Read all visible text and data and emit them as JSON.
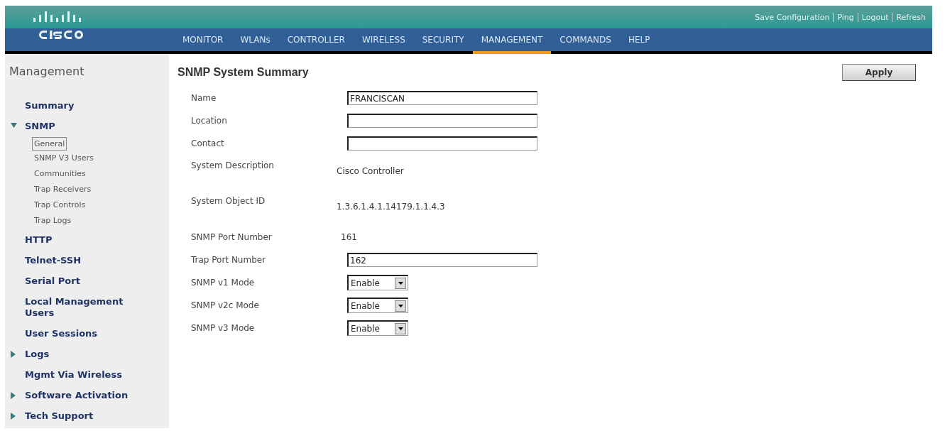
{
  "header": {
    "top_links": [
      "Save Configuration",
      "Ping",
      "Logout",
      "Refresh"
    ],
    "nav": [
      {
        "label": "MONITOR",
        "selected": false
      },
      {
        "label": "WLANs",
        "selected": false
      },
      {
        "label": "CONTROLLER",
        "selected": false
      },
      {
        "label": "WIRELESS",
        "selected": false
      },
      {
        "label": "SECURITY",
        "selected": false
      },
      {
        "label": "MANAGEMENT",
        "selected": true
      },
      {
        "label": "COMMANDS",
        "selected": false
      },
      {
        "label": "HELP",
        "selected": false
      }
    ]
  },
  "sidebar": {
    "title": "Management",
    "items": [
      {
        "label": "Summary"
      },
      {
        "label": "SNMP",
        "expanded": true,
        "children": [
          {
            "label": "General",
            "selected": true
          },
          {
            "label": "SNMP V3 Users",
            "selected": false
          },
          {
            "label": "Communities",
            "selected": false
          },
          {
            "label": "Trap Receivers",
            "selected": false
          },
          {
            "label": "Trap Controls",
            "selected": false
          },
          {
            "label": "Trap Logs",
            "selected": false
          }
        ]
      },
      {
        "label": "HTTP"
      },
      {
        "label": "Telnet-SSH"
      },
      {
        "label": "Serial Port"
      },
      {
        "label": "Local Management Users"
      },
      {
        "label": "User Sessions"
      },
      {
        "label": "Logs",
        "expanded": false
      },
      {
        "label": "Mgmt Via Wireless"
      },
      {
        "label": "Software Activation",
        "expanded": false
      },
      {
        "label": "Tech Support",
        "expanded": false
      }
    ]
  },
  "form": {
    "title": "SNMP System Summary",
    "apply_button": "Apply",
    "fields": [
      {
        "kind": "input",
        "label": "Name",
        "value": "FRANCISCAN"
      },
      {
        "kind": "input",
        "label": "Location"
      },
      {
        "kind": "input",
        "label": "Contact"
      },
      {
        "kind": "static",
        "label": "System Description",
        "value": "Cisco Controller"
      },
      {
        "kind": "static",
        "label": "System Object ID",
        "value": "1.3.6.1.4.1.14179.1.1.4.3"
      },
      {
        "kind": "number",
        "label": "SNMP Port Number",
        "value": "161"
      },
      {
        "kind": "input",
        "label": "Trap Port Number",
        "value": "162"
      },
      {
        "kind": "select",
        "label": "SNMP v1 Mode",
        "value": "Enable"
      },
      {
        "kind": "select",
        "label": "SNMP v2c Mode",
        "value": "Enable"
      },
      {
        "kind": "select",
        "label": "SNMP v3 Mode",
        "value": "Enable"
      }
    ]
  }
}
